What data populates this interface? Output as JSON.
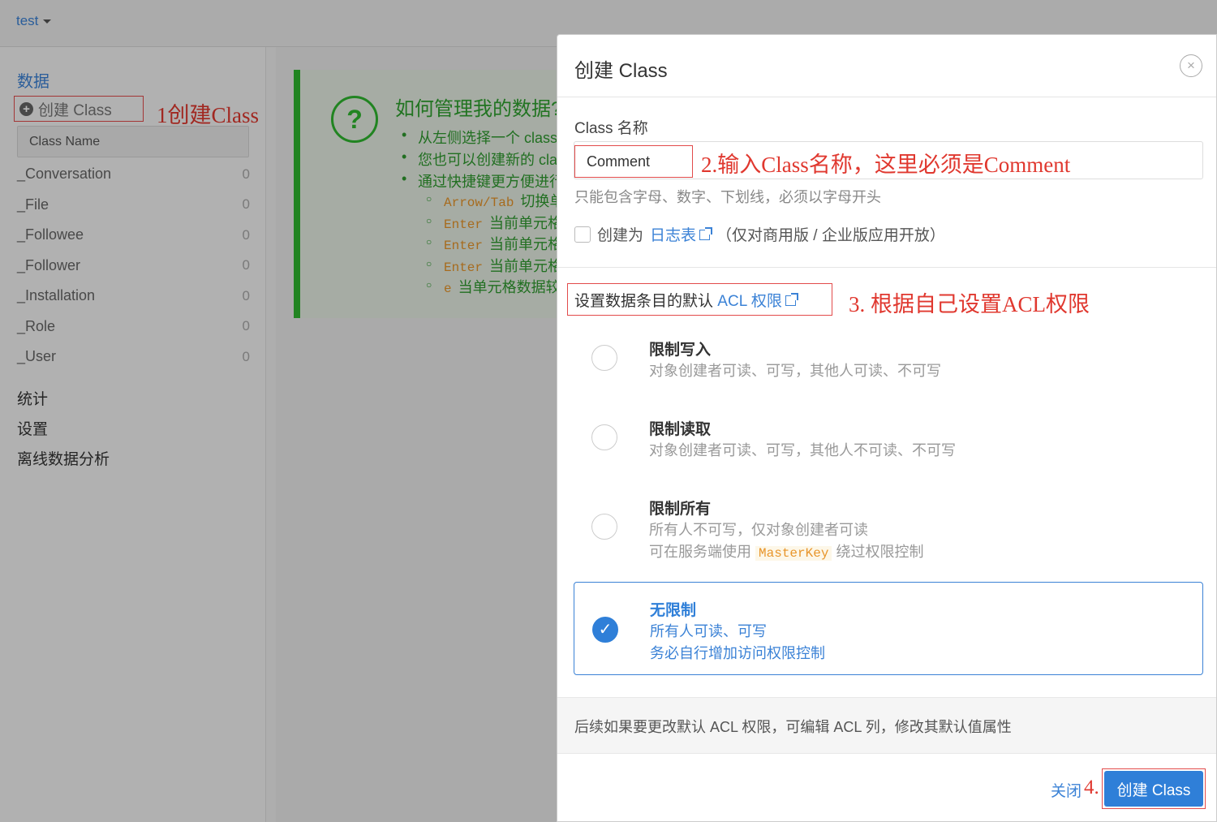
{
  "app": {
    "name": "test"
  },
  "sidebar": {
    "section_title": "数据",
    "create_class_label": "创建 Class",
    "annotation": "1创建Class",
    "search_placeholder": "Class Name",
    "classes": [
      {
        "name": "_Conversation",
        "count": "0"
      },
      {
        "name": "_File",
        "count": "0"
      },
      {
        "name": "_Followee",
        "count": "0"
      },
      {
        "name": "_Follower",
        "count": "0"
      },
      {
        "name": "_Installation",
        "count": "0"
      },
      {
        "name": "_Role",
        "count": "0"
      },
      {
        "name": "_User",
        "count": "0"
      }
    ],
    "nav": [
      "统计",
      "设置",
      "离线数据分析"
    ]
  },
  "help": {
    "icon": "?",
    "title": "如何管理我的数据?",
    "items": [
      "从左侧选择一个 class",
      "您也可以创建新的 cla",
      "通过快捷键更方便进行"
    ],
    "sub_items": [
      {
        "key": "Arrow/Tab",
        "text": "切换单"
      },
      {
        "key": "Enter",
        "text": "当前单元格"
      },
      {
        "key": "Enter",
        "text": "当前单元格"
      },
      {
        "key": "Enter",
        "text": "当前单元格"
      },
      {
        "key": "e",
        "text": "当单元格数据较"
      }
    ]
  },
  "modal": {
    "title": "创建 Class",
    "close_icon": "×",
    "name_label": "Class 名称",
    "name_value": "Comment",
    "annotation_2": "2.输入Class名称，这里必须是Comment",
    "name_hint": "只能包含字母、数字、下划线，必须以字母开头",
    "log_prefix": "创建为",
    "log_link": "日志表",
    "log_suffix": "（仅对商用版 / 企业版应用开放）",
    "acl_prefix": "设置数据条目的默认",
    "acl_link": "ACL 权限",
    "annotation_3": "3. 根据自己设置ACL权限",
    "options": [
      {
        "title": "限制写入",
        "line1": "对象创建者可读、可写，其他人可读、不可写"
      },
      {
        "title": "限制读取",
        "line1": "对象创建者可读、可写，其他人不可读、不可写"
      },
      {
        "title": "限制所有",
        "line1": "所有人不可写，仅对象创建者可读",
        "line2_prefix": "可在服务端使用",
        "line2_code": "MasterKey",
        "line2_suffix": "绕过权限控制"
      },
      {
        "title": "无限制",
        "line1": "所有人可读、可写",
        "line2": "务必自行增加访问权限控制"
      }
    ],
    "note": "后续如果要更改默认 ACL 权限，可编辑 ACL 列，修改其默认值属性",
    "close_label": "关闭",
    "annotation_4": "4.",
    "submit_label": "创建 Class"
  }
}
